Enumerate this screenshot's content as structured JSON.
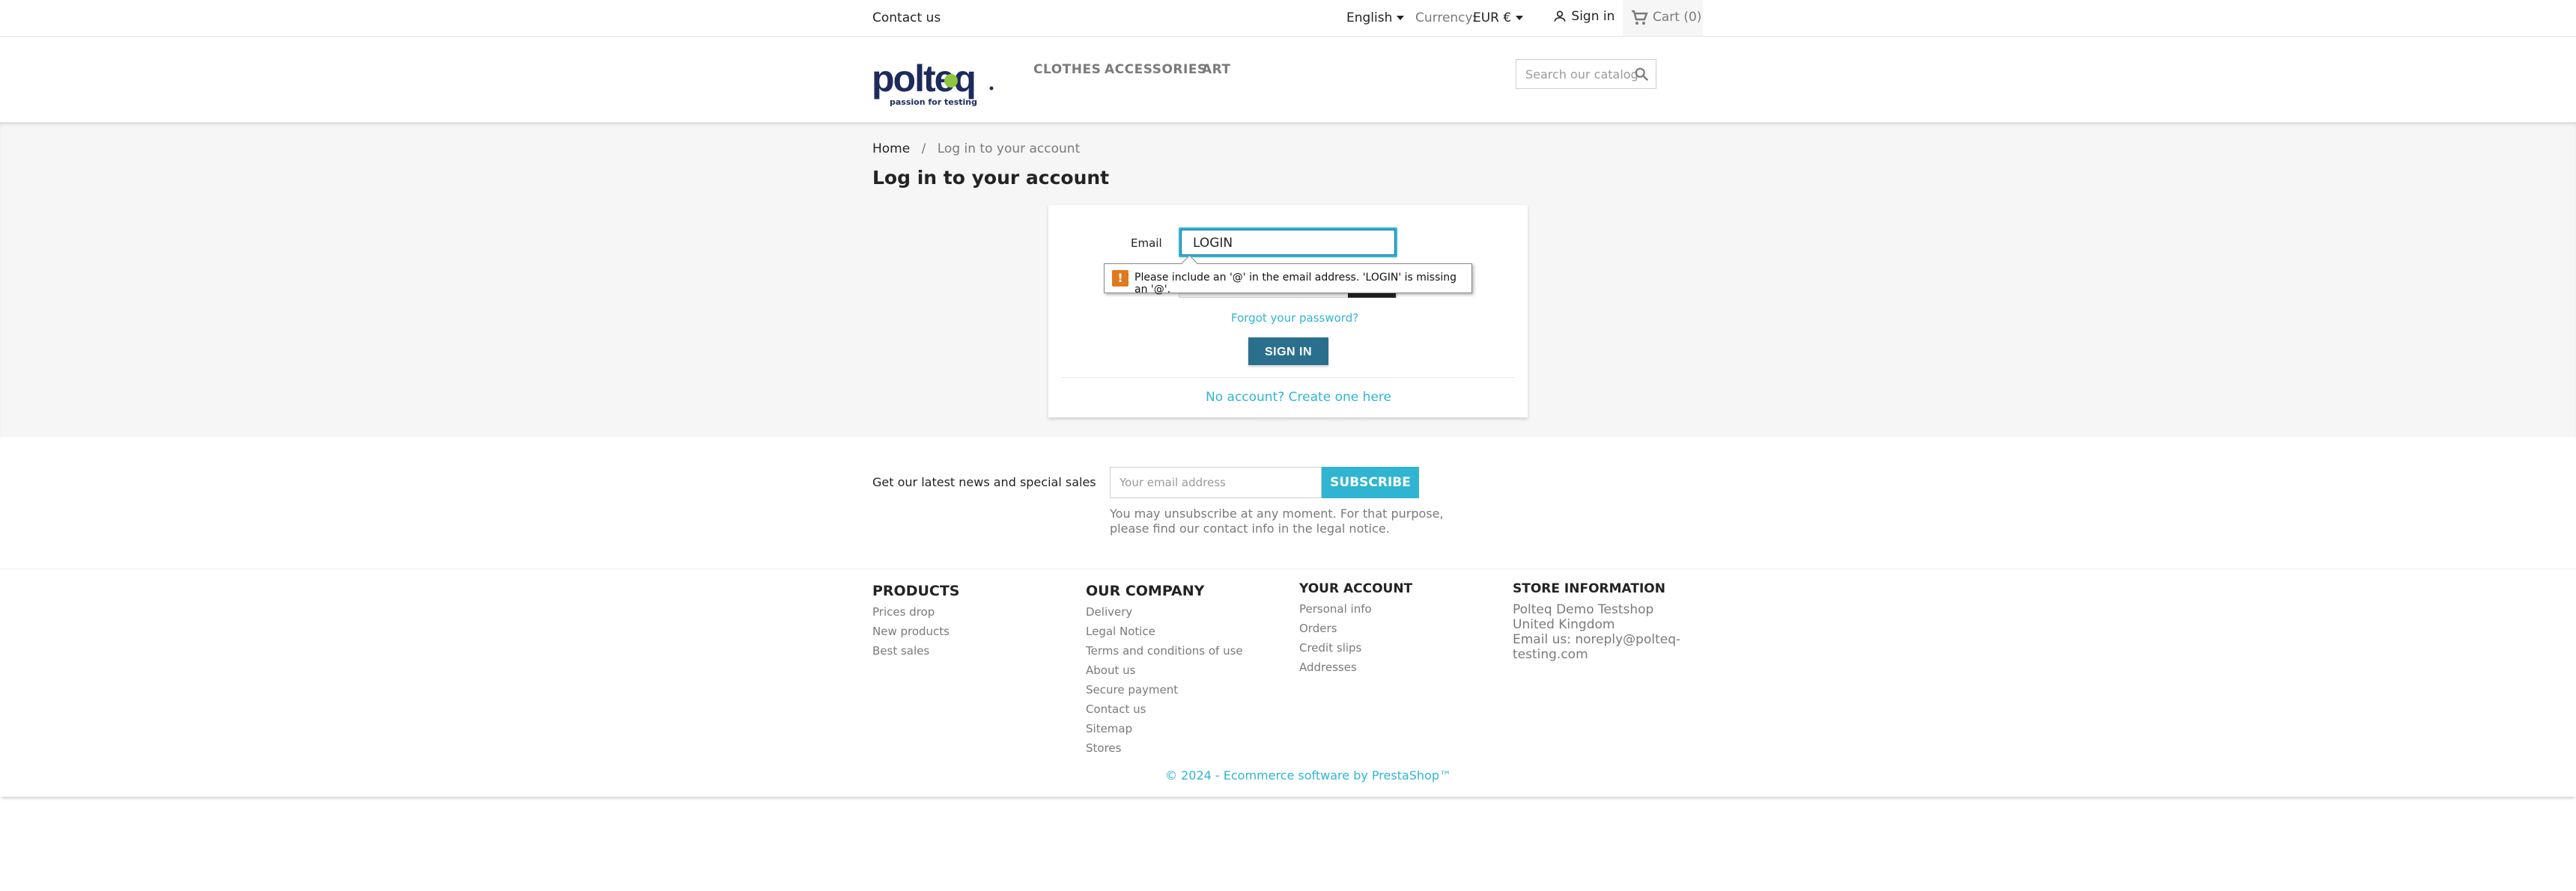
{
  "topbar": {
    "contact": "Contact us",
    "language": "English",
    "currency_label": "Currency:",
    "currency_value": "EUR €",
    "sign_in": "Sign in",
    "cart": "Cart (0)"
  },
  "header": {
    "logo_text": "polteq",
    "logo_tagline": "passion for testing",
    "menu": [
      "CLOTHES",
      "ACCESSORIES",
      "ART"
    ],
    "search_placeholder": "Search our catalog"
  },
  "breadcrumb": {
    "home": "Home",
    "sep": "/",
    "current": "Log in to your account"
  },
  "page_title": "Log in to your account",
  "login": {
    "email_label": "Email",
    "email_value": "LOGIN",
    "validation_message": "Please include an '@' in the email address. 'LOGIN' is missing an '@'.",
    "forgot": "Forgot your password?",
    "submit": "SIGN IN",
    "no_account": "No account? Create one here"
  },
  "newsletter": {
    "text": "Get our latest news and special sales",
    "placeholder": "Your email address",
    "button": "SUBSCRIBE",
    "note_line1": "You may unsubscribe at any moment. For that purpose,",
    "note_line2": "please find our contact info in the legal notice."
  },
  "footer": {
    "products": {
      "title": "PRODUCTS",
      "links": [
        "Prices drop",
        "New products",
        "Best sales"
      ]
    },
    "company": {
      "title": "OUR COMPANY",
      "links": [
        "Delivery",
        "Legal Notice",
        "Terms and conditions of use",
        "About us",
        "Secure payment",
        "Contact us",
        "Sitemap",
        "Stores"
      ]
    },
    "account": {
      "title": "YOUR ACCOUNT",
      "links": [
        "Personal info",
        "Orders",
        "Credit slips",
        "Addresses"
      ]
    },
    "store": {
      "title": "STORE INFORMATION",
      "lines": [
        "Polteq Demo Testshop",
        "United Kingdom",
        "Email us: noreply@polteq-",
        "testing.com"
      ]
    },
    "copyright": "© 2024 - Ecommerce software by PrestaShop™"
  },
  "colors": {
    "accent": "#2fb5d2",
    "button_dark": "#2b6f8f",
    "warning": "#e0781c",
    "logo_navy": "#1d2a5c",
    "logo_green": "#8cc63f"
  }
}
